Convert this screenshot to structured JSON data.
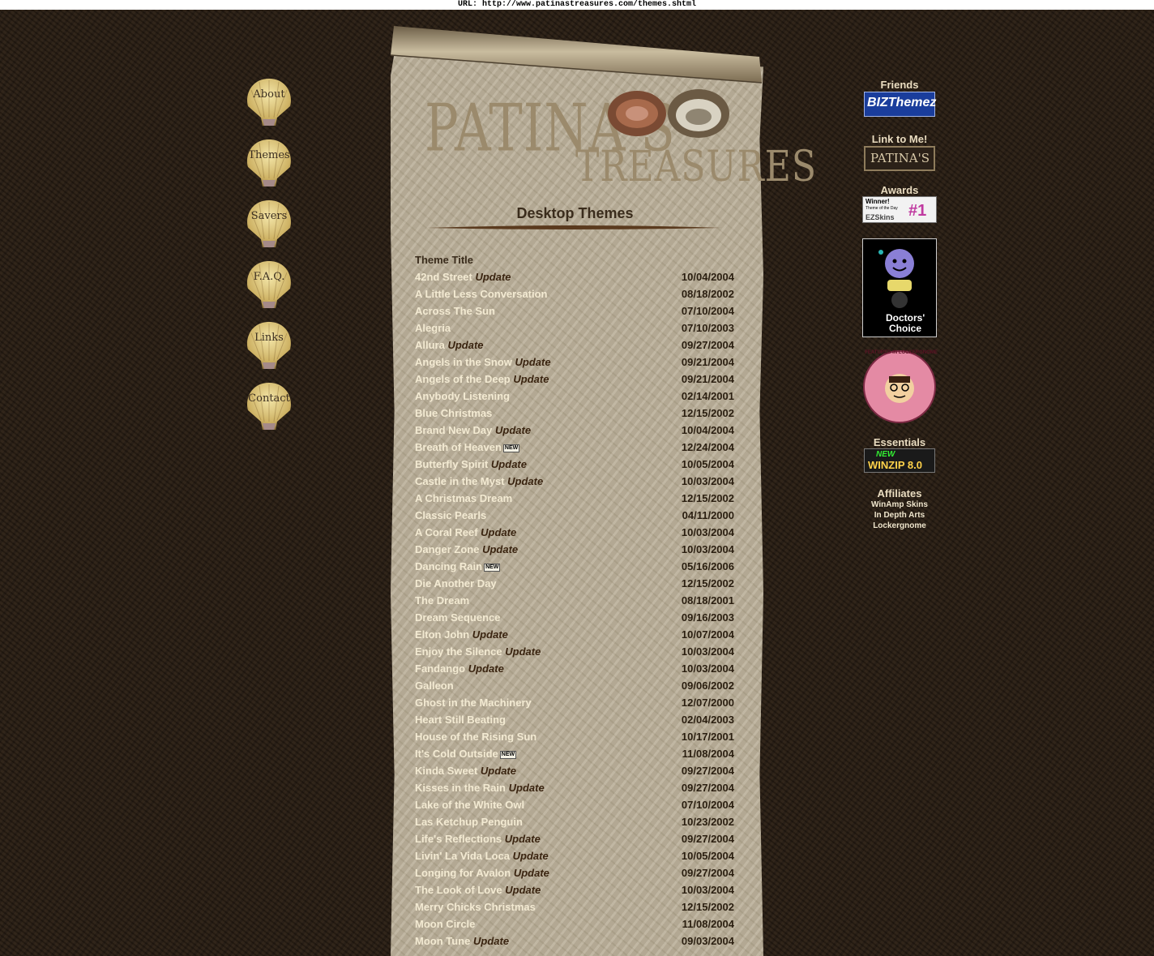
{
  "url_bar": "URL: http://www.patinastreasures.com/themes.shtml",
  "nav": [
    {
      "label": "About"
    },
    {
      "label": "Themes"
    },
    {
      "label": "Savers"
    },
    {
      "label": "F.A.Q."
    },
    {
      "label": "Links"
    },
    {
      "label": "Contact"
    }
  ],
  "logo": {
    "line1": "PATINA'S",
    "line2": "TREASURES"
  },
  "page_title": "Desktop Themes",
  "table": {
    "header": "Theme Title",
    "rows": [
      {
        "title": "42nd Street",
        "tag": "Update",
        "date": "10/04/2004"
      },
      {
        "title": "A Little Less Conversation",
        "tag": "",
        "date": "08/18/2002"
      },
      {
        "title": "Across The Sun",
        "tag": "",
        "date": "07/10/2004"
      },
      {
        "title": "Alegria",
        "tag": "",
        "date": "07/10/2003"
      },
      {
        "title": "Allura",
        "tag": "Update",
        "date": "09/27/2004"
      },
      {
        "title": "Angels in the Snow",
        "tag": "Update",
        "date": "09/21/2004"
      },
      {
        "title": "Angels of the Deep",
        "tag": "Update",
        "date": "09/21/2004"
      },
      {
        "title": "Anybody Listening",
        "tag": "",
        "date": "02/14/2001"
      },
      {
        "title": "Blue Christmas",
        "tag": "",
        "date": "12/15/2002"
      },
      {
        "title": "Brand New Day",
        "tag": "Update",
        "date": "10/04/2004"
      },
      {
        "title": "Breath of Heaven",
        "tag": "NEW",
        "date": "12/24/2004"
      },
      {
        "title": "Butterfly Spirit",
        "tag": "Update",
        "date": "10/05/2004"
      },
      {
        "title": "Castle in the Myst",
        "tag": "Update",
        "date": "10/03/2004"
      },
      {
        "title": "A Christmas Dream",
        "tag": "",
        "date": "12/15/2002"
      },
      {
        "title": "Classic Pearls",
        "tag": "",
        "date": "04/11/2000"
      },
      {
        "title": "A Coral Reef",
        "tag": "Update",
        "date": "10/03/2004"
      },
      {
        "title": "Danger Zone",
        "tag": "Update",
        "date": "10/03/2004"
      },
      {
        "title": "Dancing Rain",
        "tag": "NEW",
        "date": "05/16/2006"
      },
      {
        "title": "Die Another Day",
        "tag": "",
        "date": "12/15/2002"
      },
      {
        "title": "The Dream",
        "tag": "",
        "date": "08/18/2001"
      },
      {
        "title": "Dream Sequence",
        "tag": "",
        "date": "09/16/2003"
      },
      {
        "title": "Elton John",
        "tag": "Update",
        "date": "10/07/2004"
      },
      {
        "title": "Enjoy the Silence",
        "tag": "Update",
        "date": "10/03/2004"
      },
      {
        "title": "Fandango",
        "tag": "Update",
        "date": "10/03/2004"
      },
      {
        "title": "Galleon",
        "tag": "",
        "date": "09/06/2002"
      },
      {
        "title": "Ghost in the Machinery",
        "tag": "",
        "date": "12/07/2000"
      },
      {
        "title": "Heart Still Beating",
        "tag": "",
        "date": "02/04/2003"
      },
      {
        "title": "House of the Rising Sun",
        "tag": "",
        "date": "10/17/2001"
      },
      {
        "title": "It's Cold Outside",
        "tag": "NEW",
        "date": "11/08/2004"
      },
      {
        "title": "Kinda Sweet",
        "tag": "Update",
        "date": "09/27/2004"
      },
      {
        "title": "Kisses in the Rain",
        "tag": "Update",
        "date": "09/27/2004"
      },
      {
        "title": "Lake of the White Owl",
        "tag": "",
        "date": "07/10/2004"
      },
      {
        "title": "Las Ketchup Penguin",
        "tag": "",
        "date": "10/23/2002"
      },
      {
        "title": "Life's Reflections",
        "tag": "Update",
        "date": "09/27/2004"
      },
      {
        "title": "Livin' La Vida Loca",
        "tag": "Update",
        "date": "10/05/2004"
      },
      {
        "title": "Longing for Avalon",
        "tag": "Update",
        "date": "09/27/2004"
      },
      {
        "title": "The Look of Love",
        "tag": "Update",
        "date": "10/03/2004"
      },
      {
        "title": "Merry Chicks Christmas",
        "tag": "",
        "date": "12/15/2002"
      },
      {
        "title": "Moon Circle",
        "tag": "",
        "date": "11/08/2004"
      },
      {
        "title": "Moon Tune",
        "tag": "Update",
        "date": "09/03/2004"
      }
    ]
  },
  "sidebar": {
    "friends_heading": "Friends",
    "friends_badge": "BIZThemez",
    "link_heading": "Link to Me!",
    "link_badge": "PATINA'S",
    "awards_heading": "Awards",
    "award_badge_line1": "Winner!",
    "award_badge_line2": "Theme of the Day",
    "award_badge_brand": "EZSkins",
    "award_badge_rank": "#1",
    "doctors_line1": "Doctors'",
    "doctors_line2": "Choice",
    "lockergnome_text": "FEATURED IN LOCKERGNOME",
    "essentials_heading": "Essentials",
    "winzip_new": "NEW",
    "winzip_text": "WINZIP 8.0",
    "affiliates_heading": "Affiliates",
    "affiliates": [
      "WinAmp Skins",
      "In Depth Arts",
      "Lockergnome"
    ]
  }
}
